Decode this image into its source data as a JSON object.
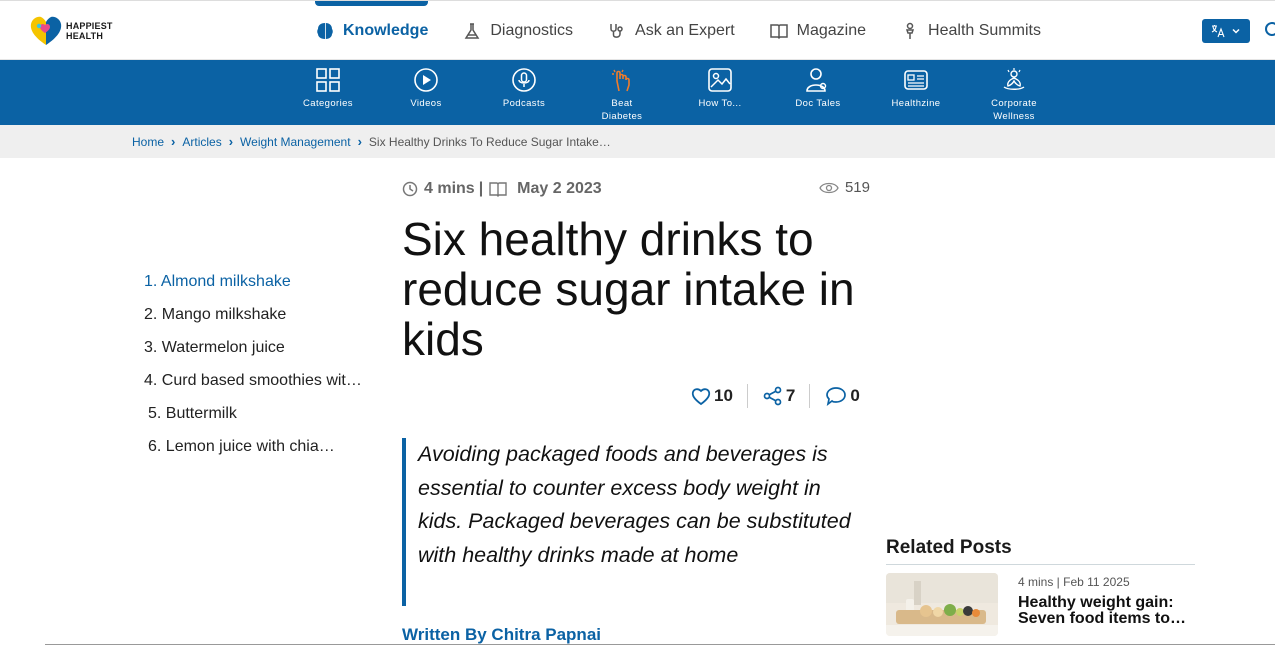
{
  "brand": {
    "line1": "HAPPIEST",
    "line2": "HEALTH",
    "accent": "#0b62a4"
  },
  "topnav": {
    "items": [
      {
        "label": "Knowledge",
        "icon": "brain-icon",
        "active": true
      },
      {
        "label": "Diagnostics",
        "icon": "flask-icon"
      },
      {
        "label": "Ask an Expert",
        "icon": "stethoscope-icon"
      },
      {
        "label": "Magazine",
        "icon": "book-icon"
      },
      {
        "label": "Health Summits",
        "icon": "microphone-icon"
      }
    ],
    "language_icon": "translate-icon"
  },
  "subnav": {
    "items": [
      {
        "label": "Categories",
        "label2": "",
        "icon": "grid-icon"
      },
      {
        "label": "Videos",
        "label2": "",
        "icon": "play-icon"
      },
      {
        "label": "Podcasts",
        "label2": "",
        "icon": "mic-icon"
      },
      {
        "label": "Beat",
        "label2": "Diabetes",
        "icon": "finger-prick-icon"
      },
      {
        "label": "How To...",
        "label2": "",
        "icon": "image-icon"
      },
      {
        "label": "Doc Tales",
        "label2": "",
        "icon": "doctor-icon"
      },
      {
        "label": "Healthzine",
        "label2": "",
        "icon": "newspaper-icon"
      },
      {
        "label": "Corporate",
        "label2": "Wellness",
        "icon": "lotus-icon"
      }
    ]
  },
  "breadcrumb": {
    "items": [
      "Home",
      "Articles",
      "Weight Management"
    ],
    "current": "Six Healthy Drinks To Reduce Sugar Intake…"
  },
  "toc": {
    "items": [
      "1. Almond milkshake",
      "2. Mango milkshake",
      "3. Watermelon juice",
      "4. Curd based smoothies wit…",
      "5. Buttermilk",
      "6. Lemon juice with chia…"
    ]
  },
  "article": {
    "read_time": "4 mins",
    "divider": "|",
    "date": "May 2 2023",
    "views": "519",
    "title": "Six healthy drinks to reduce sugar intake in kids",
    "likes": "10",
    "shares": "7",
    "comments": "0",
    "summary": "Avoiding packaged foods and beverages is essential to counter excess body weight in kids. Packaged beverages can be substituted with healthy drinks made at home",
    "byline": "Written By Chitra Papnai"
  },
  "related": {
    "title": "Related Posts",
    "posts": [
      {
        "meta": "4 mins | Feb 11 2025",
        "headline": "Healthy weight gain: Seven food items to…"
      }
    ]
  }
}
